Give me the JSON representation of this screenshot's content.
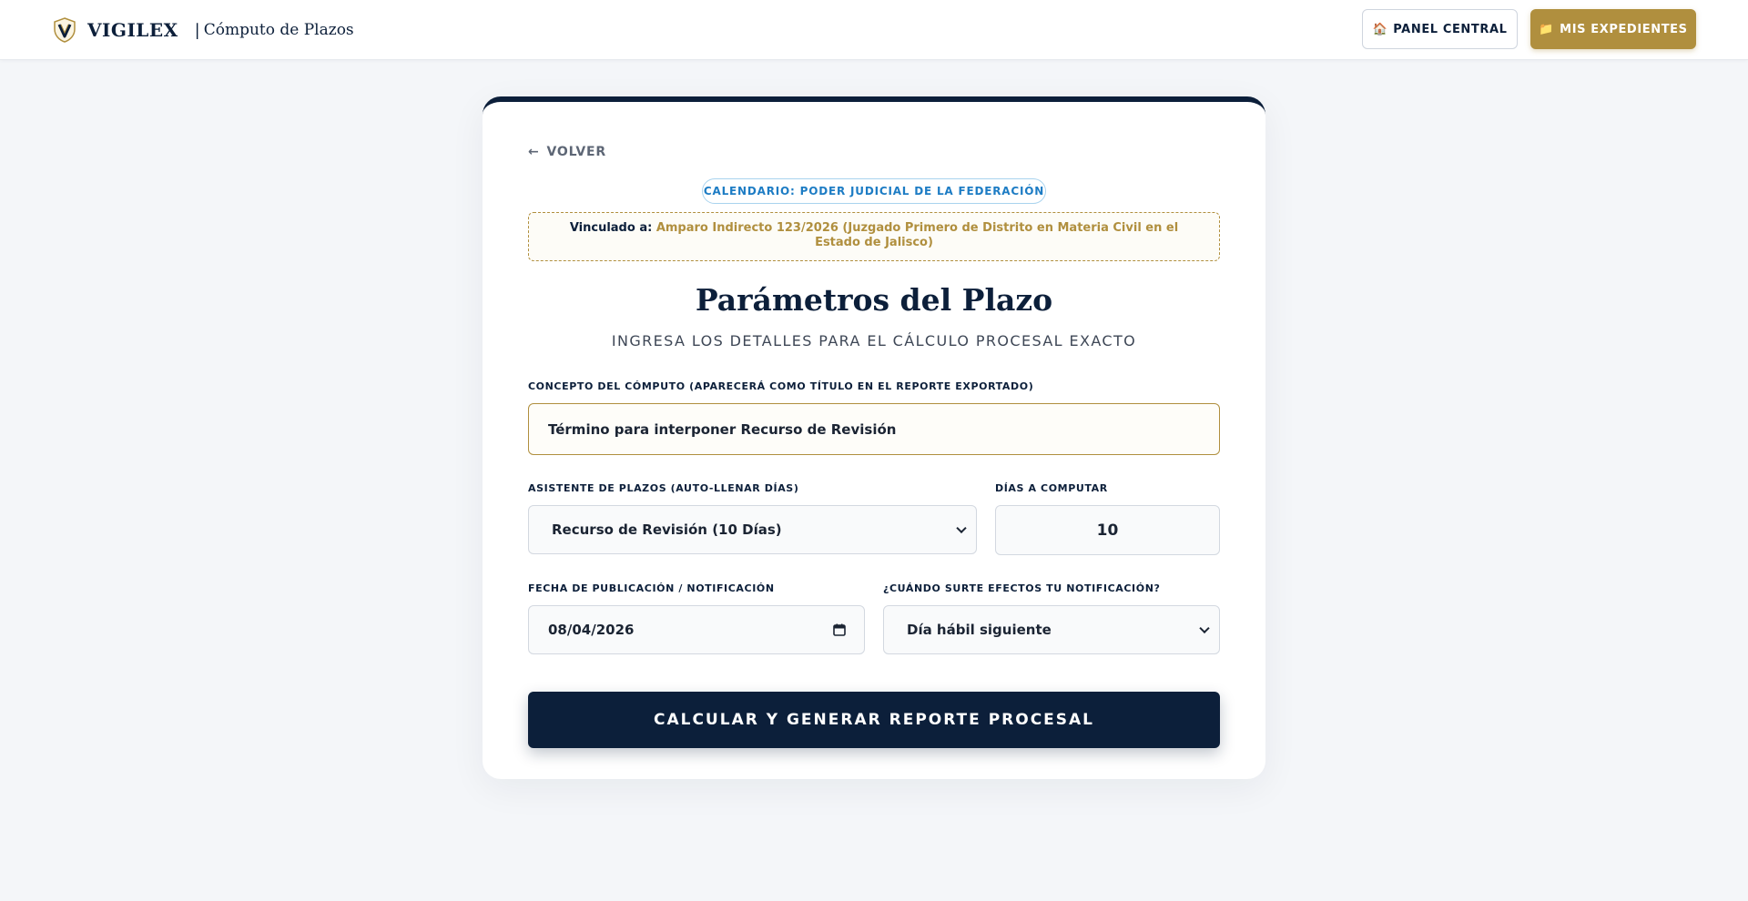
{
  "header": {
    "brand_name": "VIGILEX",
    "brand_separator": "|",
    "brand_subtitle": "Cómputo de Plazos",
    "panel_button": "PANEL CENTRAL",
    "panel_icon": "🏠",
    "expedientes_button": "MIS EXPEDIENTES",
    "expedientes_icon": "📁"
  },
  "card": {
    "back_label": "VOLVER",
    "calendar_badge": "CALENDARIO: PODER JUDICIAL DE LA FEDERACIÓN",
    "linked_label": "Vinculado a:",
    "linked_value": "Amparo Indirecto 123/2026 (Juzgado Primero de Distrito en Materia Civil en el Estado de Jalisco)",
    "title": "Parámetros del Plazo",
    "subtitle": "INGRESA LOS DETALLES PARA EL CÁLCULO PROCESAL EXACTO"
  },
  "form": {
    "concept": {
      "label": "CONCEPTO DEL CÓMPUTO (APARECERÁ COMO TÍTULO EN EL REPORTE EXPORTADO)",
      "value": "Término para interponer Recurso de Revisión"
    },
    "assistant": {
      "label": "ASISTENTE DE PLAZOS (AUTO-LLENAR DÍAS)",
      "selected": "Recurso de Revisión (10 Días)"
    },
    "days": {
      "label": "DÍAS A COMPUTAR",
      "value": "10"
    },
    "date": {
      "label": "FECHA DE PUBLICACIÓN / NOTIFICACIÓN",
      "value": "08/04/2026"
    },
    "effect": {
      "label": "¿CUÁNDO SURTE EFECTOS TU NOTIFICACIÓN?",
      "selected": "Día hábil siguiente"
    },
    "submit_label": "CALCULAR Y GENERAR REPORTE PROCESAL"
  },
  "colors": {
    "navy": "#0c1f3a",
    "gold": "#b08f3e",
    "badge_blue": "#1d7cc4",
    "background": "#f4f6f9"
  }
}
